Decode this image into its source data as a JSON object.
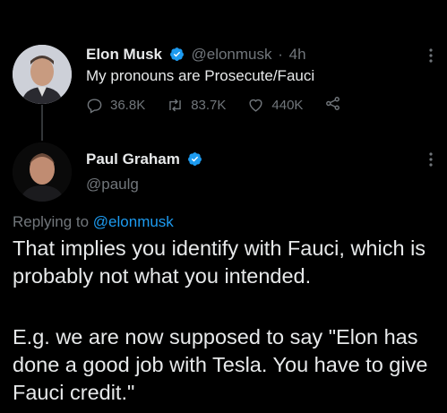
{
  "tweet1": {
    "author_name": "Elon Musk",
    "author_handle": "@elonmusk",
    "separator": "·",
    "time": "4h",
    "text": "My pronouns are Prosecute/Fauci",
    "replies": "36.8K",
    "retweets": "83.7K",
    "likes": "440K"
  },
  "tweet2": {
    "author_name": "Paul Graham",
    "author_handle": "@paulg",
    "replying_prefix": "Replying to",
    "replying_to": "@elonmusk",
    "text_para1": "That implies you identify with Fauci, which is probably not what you intended.",
    "text_para2": "E.g. we are now supposed to say \"Elon has done a good job with Tesla. You have to give Fauci credit.\""
  },
  "colors": {
    "background": "#000000",
    "text": "#e7e9ea",
    "muted": "#71767b",
    "accent": "#1d9bf0"
  },
  "icons": [
    "verified-badge-icon",
    "more-icon",
    "reply-icon",
    "retweet-icon",
    "like-icon",
    "share-icon"
  ]
}
